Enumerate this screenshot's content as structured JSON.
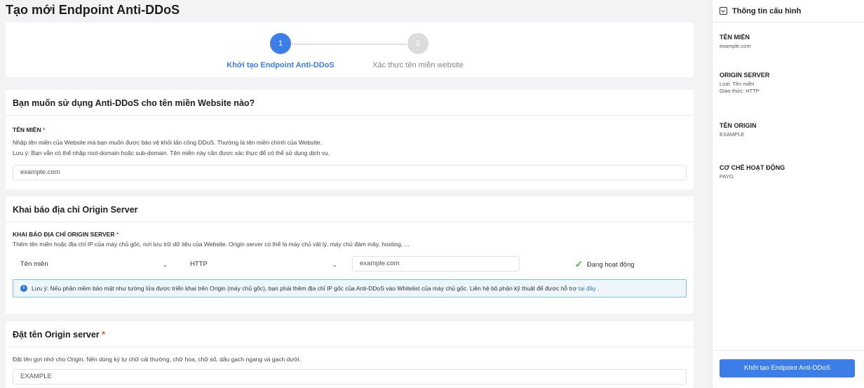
{
  "page": {
    "title": "Tạo mới Endpoint Anti-DDoS"
  },
  "stepper": {
    "steps": [
      {
        "number": "1",
        "label": "Khởi tạo Endpoint Anti-DDoS",
        "active": true
      },
      {
        "number": "2",
        "label": "Xác thực tên miền website",
        "active": false
      }
    ]
  },
  "domain_section": {
    "title": "Bạn muốn sử dụng Anti-DDoS cho tên miền Website nào?",
    "field_label": "TÊN MIỀN",
    "required_mark": "*",
    "help_line1": "Nhập tên miền của Website mà bạn muốn được bảo vệ khỏi tấn công DDoS. Thường là tên miền chính của Website.",
    "help_line2": "Lưu ý: Bạn vẫn có thể nhập root-domain hoặc sub-domain. Tên miền này cần được xác thực để có thể sử dụng dịch vụ.",
    "input_value": "example.com"
  },
  "origin_section": {
    "title": "Khai báo địa chỉ Origin Server",
    "field_label": "KHAI BÁO ĐỊA CHỈ ORIGIN SERVER",
    "required_mark": "*",
    "help": "Thêm tên miền hoặc địa chỉ IP của máy chủ gốc, nơi lưu trữ dữ liệu của Website. Origin server có thể là máy chủ vật lý, máy chủ đám mây, hosting, ...",
    "type_select": "Tên miền",
    "protocol_select": "HTTP",
    "address_value": "example.com",
    "status": "Đang hoạt động",
    "alert_text": "Lưu ý: Nếu phần mềm bảo mật như tường lửa được triển khai trên Origin (máy chủ gốc), bạn phải thêm địa chỉ IP gốc của Anti-DDoS vào Whitelist của máy chủ gốc. Liên hệ bộ phận kỹ thuật để được hỗ trợ",
    "alert_link": "tại đây",
    "alert_end": "."
  },
  "name_section": {
    "title": "Đặt tên Origin server",
    "required_mark": "*",
    "help": "Đặt tên gợi nhớ cho Origin. Nên dùng ký tự chữ cái thường, chữ hoa, chữ số, dấu gạch ngang và gạch dưới.",
    "input_value": "EXAMPLE"
  },
  "sidebar": {
    "title": "Thông tin cấu hình",
    "domain_title": "TÊN MIỀN",
    "domain_value": "example.com",
    "origin_title": "ORIGIN SERVER",
    "origin_type": "Loại: Tên miền",
    "origin_protocol": "Giao thức: HTTP",
    "origin_name_title": "TÊN ORIGIN",
    "origin_name_value": "EXAMPLE",
    "mechanism_title": "CƠ CHẾ HOẠT ĐỘNG",
    "mechanism_value": "PAYG",
    "submit_label": "Khởi tạo Endpoint Anti-DDoS"
  },
  "colors": {
    "primary": "#3d7de8",
    "success": "#3bb54a",
    "required": "#e84c3d",
    "alert_border": "#7ec0e6"
  }
}
